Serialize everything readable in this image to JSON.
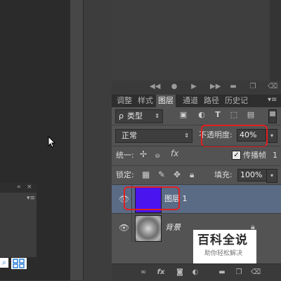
{
  "window": {
    "title": ""
  },
  "anim_toolbar": {
    "icons": [
      "first-frame-icon",
      "prev-frame-icon",
      "play-icon",
      "next-frame-icon",
      "folder-icon",
      "new-frame-icon",
      "delete-frame-icon"
    ]
  },
  "tabs": [
    {
      "label": "调整",
      "active": false
    },
    {
      "label": "样式",
      "active": false
    },
    {
      "label": "图层",
      "active": true
    },
    {
      "label": "通道",
      "active": false
    },
    {
      "label": "路径",
      "active": false
    },
    {
      "label": "历史记",
      "active": false
    }
  ],
  "filter": {
    "kind_label": "类型",
    "prefix": "ρ"
  },
  "blend": {
    "mode": "正常",
    "opacity_label": "不透明度:",
    "opacity_value": "40%"
  },
  "unify": {
    "label": "统一:",
    "propagate_label": "传播帧",
    "propagate_frame": "1",
    "fx": "fx"
  },
  "lock": {
    "label": "锁定:",
    "fill_label": "填充:",
    "fill_value": "100%"
  },
  "layers": [
    {
      "name": "图层 1",
      "visible": true,
      "selected": true,
      "color": "#4a14ee"
    },
    {
      "name": "背景",
      "visible": true,
      "selected": false,
      "locked": true
    }
  ],
  "bottom_bar": {
    "fx": "fx"
  },
  "watermark": {
    "title": "百科全说",
    "subtitle": "助你轻松解决"
  },
  "colors": {
    "highlight": "#e02020",
    "layer_fill": "#4a14ee",
    "selected_row": "#5a6b86",
    "panel_bg": "#535353"
  }
}
